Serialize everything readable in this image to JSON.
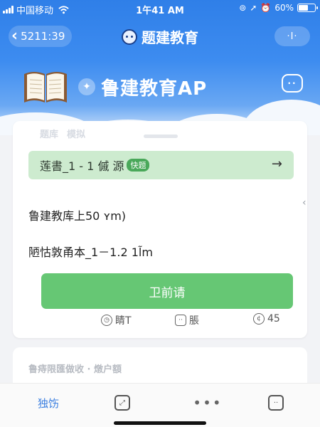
{
  "status_bar": {
    "carrier": "中国移动",
    "time": "1午41 AM",
    "battery": "60%",
    "battery_level": 0.6
  },
  "nav": {
    "back_label": "5211:39",
    "title": "题建教育",
    "more_label": "·I·"
  },
  "header": {
    "app_name": "鲁建教育AP"
  },
  "card": {
    "tabs": [
      "题库",
      "模拟"
    ],
    "banner_text": "莲書_1 - 1  傶  源",
    "banner_badge": "快题",
    "line1": "鲁建教库上50 ʏm)",
    "line2": "陋怙敦甬本_1－1.2  1l̃m",
    "primary_button": "卫前请",
    "stats": [
      {
        "icon": "clock-icon",
        "label": "睛T"
      },
      {
        "icon": "chat-icon",
        "label": "脹"
      },
      {
        "icon": "coin-icon",
        "label": "45"
      }
    ]
  },
  "card2": {
    "text": "鲁痔限匯做收 ·    燉户額"
  },
  "tabbar": {
    "home_label": "独饬"
  },
  "colors": {
    "primary_blue": "#2f7fe8",
    "success_green": "#66c774",
    "banner_green": "#cdebcf"
  }
}
